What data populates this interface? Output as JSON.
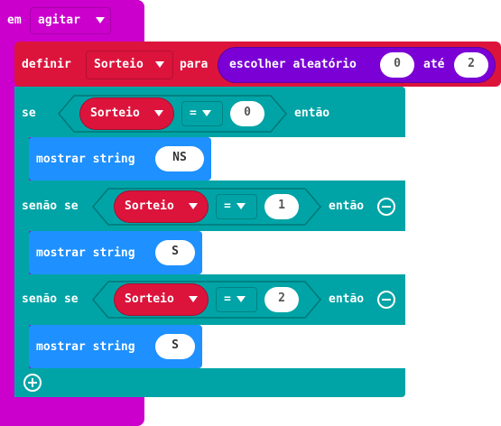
{
  "event": {
    "prefix": "em",
    "dropdown": "agitar"
  },
  "set": {
    "label": "definir",
    "variable": "Sorteio",
    "to_label": "para"
  },
  "random": {
    "label": "escolher aleatório",
    "from": "0",
    "to_label": "até",
    "to": "2"
  },
  "if_block": {
    "if_label": "se",
    "else_if_label": "senão se",
    "then_label": "então",
    "conditions": [
      {
        "variable": "Sorteio",
        "operator": "=",
        "value": "0"
      },
      {
        "variable": "Sorteio",
        "operator": "=",
        "value": "1"
      },
      {
        "variable": "Sorteio",
        "operator": "=",
        "value": "2"
      }
    ],
    "actions": [
      {
        "label": "mostrar string",
        "value": "NS"
      },
      {
        "label": "mostrar string",
        "value": "S"
      },
      {
        "label": "mostrar string",
        "value": "S"
      }
    ]
  },
  "colors": {
    "event": "#cc00cc",
    "variables": "#dc143c",
    "logic": "#00a4a6",
    "basic": "#1e90ff",
    "math": "#7b00d6"
  },
  "icons": {
    "add": "plus-circle-icon",
    "remove": "minus-circle-icon",
    "dropdown": "triangle-down-icon"
  }
}
